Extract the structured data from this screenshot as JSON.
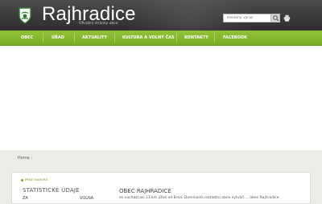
{
  "header": {
    "title": "Rajhradice",
    "subtitle": "Oficiální stránky obce",
    "search_placeholder": "Hledaný výraz",
    "icons": {
      "logo": "crest-icon",
      "search": "search-icon",
      "print": "print-icon"
    }
  },
  "nav": {
    "items": [
      {
        "label": "OBEC"
      },
      {
        "label": "ÚŘAD"
      },
      {
        "label": "AKTUALITY"
      },
      {
        "label": "KULTURA A VOLNÝ ČAS"
      },
      {
        "label": "KONTAKTY"
      },
      {
        "label": "FACEBOOK"
      }
    ]
  },
  "breadcrumb": {
    "home": "Home",
    "arrow": "›"
  },
  "content": {
    "back_link": "PŘEJÍT NAHORU",
    "left_title": "STATISTICKÉ ÚDAJE",
    "left_row_label": "ZA",
    "left_row_value": "VOLNA",
    "main_title": "OBEC RAJHRADICE",
    "main_text": "se nachází asi 13 km jižně od Brna. Dominantu katastru obce vytváří ... obec Rajhradice"
  },
  "colors": {
    "header_bg": "#3a3a3a",
    "nav_green": "#7db22a",
    "page_bg": "#ecebe7"
  }
}
